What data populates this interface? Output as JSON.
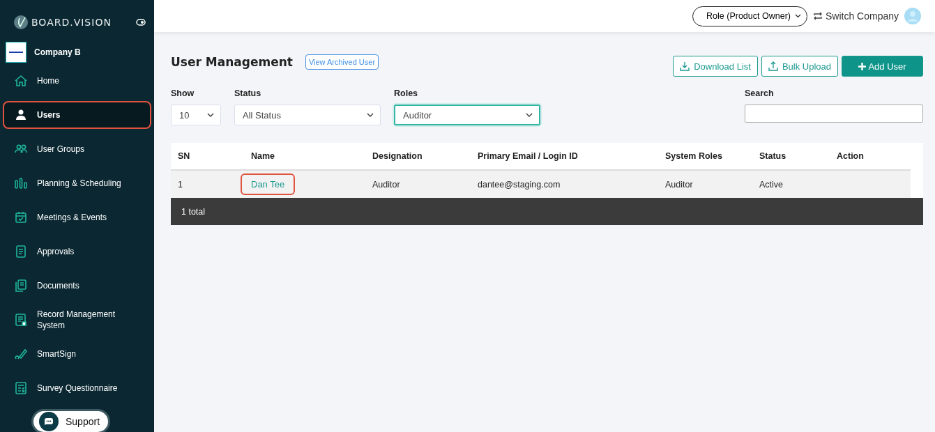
{
  "brand": {
    "name": "BOARD.VISION",
    "company": "Company B"
  },
  "sidebar": {
    "items": [
      {
        "label": "Home",
        "selected": false,
        "annotated": false
      },
      {
        "label": "Users",
        "selected": true,
        "annotated": true
      },
      {
        "label": "User Groups",
        "selected": false,
        "annotated": false
      },
      {
        "label": "Planning & Scheduling",
        "selected": false,
        "annotated": false
      },
      {
        "label": "Meetings & Events",
        "selected": false,
        "annotated": false
      },
      {
        "label": "Approvals",
        "selected": false,
        "annotated": false
      },
      {
        "label": "Documents",
        "selected": false,
        "annotated": false
      },
      {
        "label": "Record Management System",
        "selected": false,
        "annotated": false
      },
      {
        "label": "SmartSign",
        "selected": false,
        "annotated": false
      },
      {
        "label": "Survey Questionnaire",
        "selected": false,
        "annotated": false
      }
    ],
    "support": "Support"
  },
  "header": {
    "role": "Role (Product Owner)",
    "switch": "Switch Company"
  },
  "page": {
    "title": "User Management",
    "archived_link": "View Archived User",
    "buttons": [
      {
        "label": "Download List",
        "kind": "download"
      },
      {
        "label": "Bulk Upload",
        "kind": "upload"
      },
      {
        "label": "Add User",
        "kind": "add"
      }
    ],
    "filters": [
      {
        "label": "Show",
        "value": "10",
        "focused": false,
        "kind": "select"
      },
      {
        "label": "Status",
        "value": "All Status",
        "focused": false,
        "kind": "select"
      },
      {
        "label": "Roles",
        "value": "Auditor",
        "focused": true,
        "kind": "select"
      },
      {
        "label": "Search",
        "focused": false,
        "kind": "search"
      }
    ]
  },
  "table": {
    "columns": [
      "SN",
      "Name",
      "Designation",
      "Primary Email / Login ID",
      "System Roles",
      "Status",
      "Action"
    ],
    "rows": [
      {
        "cells": [
          "1",
          "Dan Tee",
          "Auditor",
          "dantee@staging.com",
          "Auditor",
          "Active"
        ],
        "name_annotated": true
      }
    ],
    "footer": "1 total"
  }
}
